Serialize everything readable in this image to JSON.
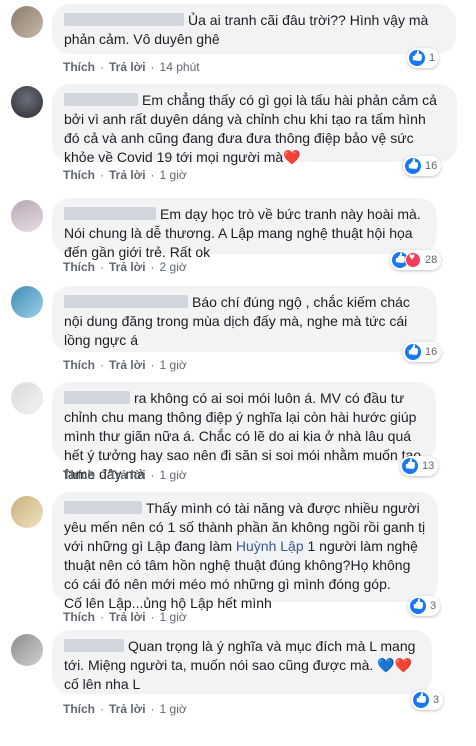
{
  "labels": {
    "like": "Thích",
    "reply": "Trả lời",
    "sep": "·"
  },
  "comments": [
    {
      "text": "Ủa ai tranh cãi đâu trời?? Hình vậy mà phản cảm. Vô duyên ghê",
      "time": "14 phút",
      "reactions": "1",
      "reaction_types": [
        "like"
      ]
    },
    {
      "text": "Em chẳng thấy có gì gọi là tấu hài phản cảm cả bởi vì anh rất duyên dáng và chỉnh chu khi tạo ra tấm hình đó cả và anh cũng đang đưa đưa thông điệp bảo vệ sức khỏe về Covid 19 tới mọi người mà",
      "emoji": "❤️",
      "time": "1 giờ",
      "reactions": "16",
      "reaction_types": [
        "like"
      ]
    },
    {
      "text": "Em dạy học trò về bức tranh này hoài mà. Nói chung là dễ thương. A Lập mang nghệ thuật hội họa đến gần giới trẻ. Rất ok",
      "time": "2 giờ",
      "reactions": "28",
      "reaction_types": [
        "like",
        "love"
      ]
    },
    {
      "text": "Báo chí đúng ngộ , chắc kiếm chác nội dung đăng trong mùa dịch đấy mà, nghe mà tức cái lồng ngực á",
      "time": "1 giờ",
      "reactions": "16",
      "reaction_types": [
        "like"
      ]
    },
    {
      "text": "ra không có ai soi mói luôn á. MV có đầu tư chỉnh chu mang thông điệp ý nghĩa lại còn hài hước giúp mình thư giãn nữa á. Chắc có lẽ do ai kia ở nhà lâu quá hết ý tưởng hay sao nên đi săn si soi mói nhằm muốn tạo fame đây mà",
      "time": "1 giờ",
      "reactions": "13",
      "reaction_types": [
        "like"
      ]
    },
    {
      "text": "Thấy mình có tài năng và được nhiều người yêu mến nên có 1 số thành phần ăn không ngồi rồi ganh tị với những gì Lập đang làm",
      "mention": "Huỳnh Lập",
      "text_after": " 1 người làm nghệ thuật nên có tâm hồn nghệ thuật đúng không?Họ không có cái đó nên mới méo mó những gì mình đóng góp.\nCố lên Lập...ủng hộ Lập hết mình",
      "time": "1 giờ",
      "reactions": "3",
      "reaction_types": [
        "like"
      ]
    },
    {
      "text": "Quan trọng là ý nghĩa và mục đích mà L mang tới. Miệng người ta, muốn nói sao cũng được mà.",
      "emoji_blue": "💙",
      "emoji_red": "❤️",
      "text_after": " cố lên nha L",
      "time": "1 giờ",
      "reactions": "3",
      "reaction_types": [
        "like"
      ]
    }
  ],
  "colors": {
    "link": "#385898",
    "like": "#1877f2",
    "love": "#f33e58",
    "bubble": "#f2f3f5"
  }
}
